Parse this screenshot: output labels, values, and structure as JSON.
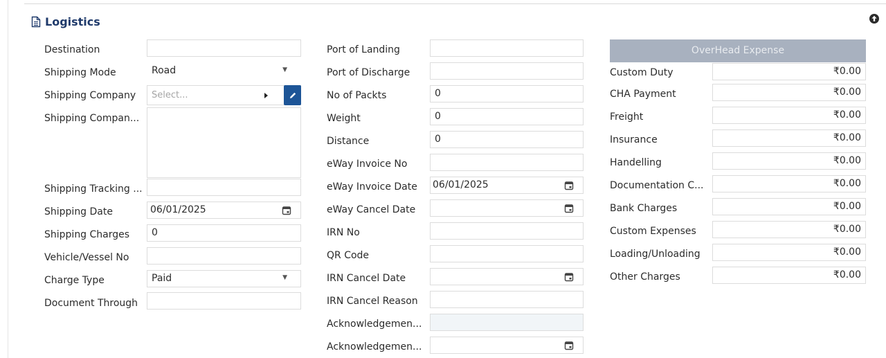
{
  "section": {
    "title": "Logistics"
  },
  "col1": {
    "destination_label": "Destination",
    "shipping_mode_label": "Shipping Mode",
    "shipping_mode_value": "Road",
    "shipping_company_label": "Shipping Company",
    "shipping_company_placeholder": "Select...",
    "shipping_company_address_label": "Shipping Compan...",
    "shipping_tracking_label": "Shipping Tracking ...",
    "shipping_date_label": "Shipping Date",
    "shipping_date_value": "06/01/2025",
    "shipping_charges_label": "Shipping Charges",
    "shipping_charges_value": "0",
    "vehicle_label": "Vehicle/Vessel No",
    "charge_type_label": "Charge Type",
    "charge_type_value": "Paid",
    "document_through_label": "Document Through"
  },
  "col2": {
    "port_landing_label": "Port of Landing",
    "port_discharge_label": "Port of Discharge",
    "packets_label": "No of Packts",
    "packets_value": "0",
    "weight_label": "Weight",
    "weight_value": "0",
    "distance_label": "Distance",
    "distance_value": "0",
    "eway_invoice_no_label": "eWay Invoice No",
    "eway_invoice_date_label": "eWay Invoice Date",
    "eway_invoice_date_value": "06/01/2025",
    "eway_cancel_date_label": "eWay Cancel Date",
    "irn_no_label": "IRN No",
    "qr_code_label": "QR Code",
    "irn_cancel_date_label": "IRN Cancel Date",
    "irn_cancel_reason_label": "IRN Cancel Reason",
    "ack_no_label": "Acknowledgemen...",
    "ack_date_label": "Acknowledgemen..."
  },
  "col3": {
    "overhead_header": "OverHead Expense",
    "rows": [
      {
        "label": "Custom Duty",
        "value": "₹0.00"
      },
      {
        "label": "CHA Payment",
        "value": "₹0.00"
      },
      {
        "label": "Freight",
        "value": "₹0.00"
      },
      {
        "label": "Insurance",
        "value": "₹0.00"
      },
      {
        "label": "Handelling",
        "value": "₹0.00"
      },
      {
        "label": "Documentation C...",
        "value": "₹0.00"
      },
      {
        "label": "Bank Charges",
        "value": "₹0.00"
      },
      {
        "label": "Custom Expenses",
        "value": "₹0.00"
      },
      {
        "label": "Loading/Unloading",
        "value": "₹0.00"
      },
      {
        "label": "Other Charges",
        "value": "₹0.00"
      }
    ]
  },
  "icons": {
    "section": "document-icon",
    "collapse": "arrow-up-circle-icon",
    "edit": "pencil-icon",
    "calendar": "calendar-icon",
    "dropdown": "caret-down-icon",
    "expand": "caret-right-icon"
  },
  "colors": {
    "title": "#1f3a6b",
    "edit_button": "#1d5597",
    "overhead_header_bg": "#a8b1bf"
  }
}
